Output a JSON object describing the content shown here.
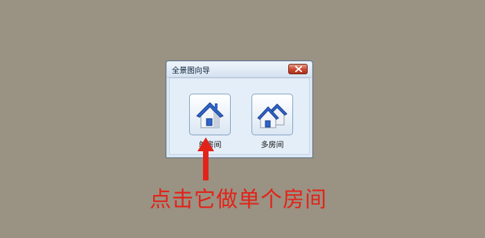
{
  "dialog": {
    "title": "全景图向导",
    "buttons": [
      {
        "label": "单房间",
        "icon": "house-icon"
      },
      {
        "label": "多房间",
        "icon": "houses-icon"
      }
    ]
  },
  "annotation": {
    "caption": "点击它做单个房间",
    "color": "#e2231a"
  },
  "colors": {
    "background": "#9a9282",
    "dialog_bg": "#dde8f3",
    "close_button": "#c9462e",
    "roof_blue": "#2f63c8"
  }
}
